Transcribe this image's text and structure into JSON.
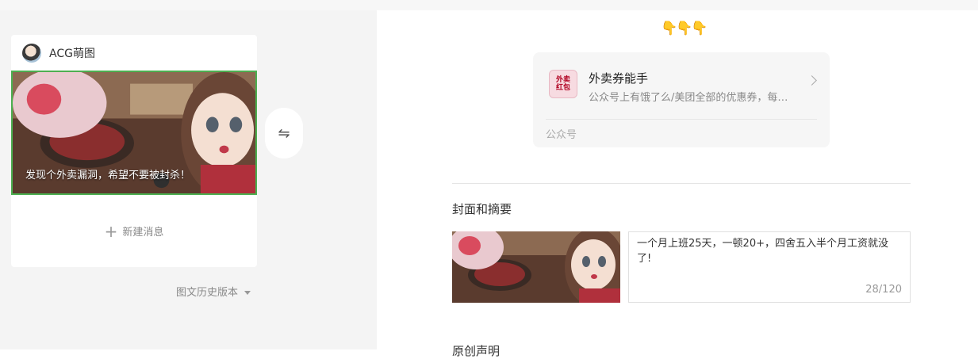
{
  "left_panel": {
    "account_name": "ACG萌图",
    "cover_title": "发现个外卖漏洞，希望不要被封杀！",
    "new_message_label": "新建消息",
    "history_label": "图文历史版本",
    "swap_icon": "⇋"
  },
  "editor": {
    "pointer_emojis": "👇👇👇",
    "mp_card": {
      "logo_text_line1": "外卖",
      "logo_text_line2": "红包",
      "name": "外卖券能手",
      "description": "公众号上有饿了么/美团全部的优惠券，每天都能领取",
      "type_label": "公众号"
    },
    "section_cover_summary": "封面和摘要",
    "summary_text": "一个月上班25天，一顿20+，四舍五入半个月工资就没了!",
    "summary_count": "28/120",
    "next_section_title": "原创声明"
  },
  "colors": {
    "selected_border": "#4caf50",
    "left_background": "#f4f4f4",
    "card_background": "#f6f6f6"
  }
}
